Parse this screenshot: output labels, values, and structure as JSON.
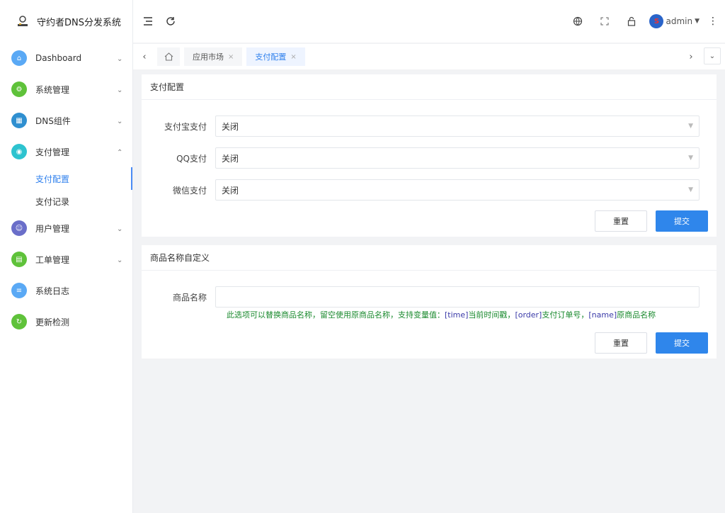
{
  "brand": {
    "title": "守约者DNS分发系统"
  },
  "sidebar": {
    "items": [
      {
        "label": "Dashboard",
        "icon": "home-icon",
        "color": "#5aa9f5",
        "expandable": true
      },
      {
        "label": "系统管理",
        "icon": "gear-icon",
        "color": "#5fc23a",
        "expandable": true
      },
      {
        "label": "DNS组件",
        "icon": "grid-icon",
        "color": "#2f8fd0",
        "expandable": true
      },
      {
        "label": "支付管理",
        "icon": "pay-icon",
        "color": "#2dc3cf",
        "expandable": true,
        "expanded": true
      },
      {
        "label": "用户管理",
        "icon": "user-icon",
        "color": "#6a6ec9",
        "expandable": true
      },
      {
        "label": "工单管理",
        "icon": "ticket-icon",
        "color": "#5fc23a",
        "expandable": true
      },
      {
        "label": "系统日志",
        "icon": "log-icon",
        "color": "#5aa9f5",
        "expandable": false
      },
      {
        "label": "更新检测",
        "icon": "update-icon",
        "color": "#5fc23a",
        "expandable": false
      }
    ],
    "submenu": [
      {
        "label": "支付配置",
        "active": true
      },
      {
        "label": "支付记录",
        "active": false
      }
    ]
  },
  "topbar": {
    "user": "admin"
  },
  "tabs": [
    {
      "label": "应用市场",
      "active": false
    },
    {
      "label": "支付配置",
      "active": true
    }
  ],
  "pay_config": {
    "title": "支付配置",
    "fields": [
      {
        "label": "支付宝支付",
        "value": "关闭"
      },
      {
        "label": "QQ支付",
        "value": "关闭"
      },
      {
        "label": "微信支付",
        "value": "关闭"
      }
    ],
    "reset_label": "重置",
    "submit_label": "提交"
  },
  "product_name": {
    "title": "商品名称自定义",
    "field_label": "商品名称",
    "value": "",
    "hint_parts": [
      {
        "text": "此选项可以替换商品名称，留空使用原商品名称，支持变量值：",
        "var": false
      },
      {
        "text": "[time]",
        "var": true
      },
      {
        "text": "当前时间戳，",
        "var": false
      },
      {
        "text": "[order]",
        "var": true
      },
      {
        "text": "支付订单号，",
        "var": false
      },
      {
        "text": "[name]",
        "var": true
      },
      {
        "text": "原商品名称",
        "var": false
      }
    ],
    "reset_label": "重置",
    "submit_label": "提交"
  }
}
